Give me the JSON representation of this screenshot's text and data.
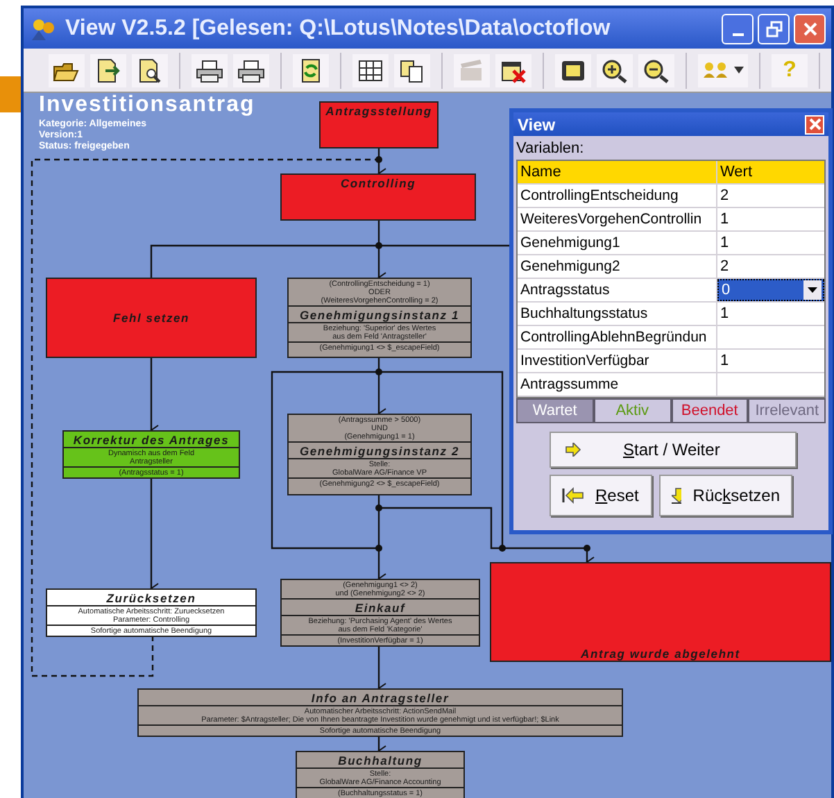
{
  "window": {
    "title": "View  V2.5.2  [Gelesen: Q:\\Lotus\\Notes\\Data\\octoflow"
  },
  "toolbar": {
    "help_glyph": "?"
  },
  "process": {
    "title": "Investitionsantrag",
    "meta": [
      "Kategorie: Allgemeines",
      "Version:1",
      "Status: freigegeben"
    ]
  },
  "nodes": [
    {
      "color": "#ec1c24",
      "sections": [
        {
          "kind": "title",
          "lines": [
            "Antragsstellung"
          ]
        }
      ]
    },
    {
      "color": "#ec1c24",
      "sections": [
        {
          "kind": "title",
          "lines": [
            "Controlling"
          ]
        }
      ]
    },
    {
      "color": "#ec1c24",
      "sections": [
        {
          "kind": "title",
          "lines": [
            "Fehl setzen"
          ]
        }
      ]
    },
    {
      "color": "#a59c98",
      "sections": [
        {
          "kind": "condition",
          "lines": [
            "(ControllingEntscheidung = 1)",
            "ODER",
            "(WeiteresVorgehenControlling = 2)"
          ]
        },
        {
          "kind": "title",
          "lines": [
            "Genehmigungsinstanz 1"
          ]
        },
        {
          "kind": "detail",
          "lines": [
            "Beziehung: 'Superior' des Wertes",
            "aus dem Feld 'Antragsteller'"
          ]
        },
        {
          "kind": "result",
          "lines": [
            "(Genehmigung1 <> $_escapeField)"
          ]
        }
      ]
    },
    {
      "color": "#66c21a",
      "sections": [
        {
          "kind": "title",
          "lines": [
            "Korrektur des Antrages"
          ]
        },
        {
          "kind": "detail",
          "lines": [
            "Dynamisch aus dem Feld",
            "Antragsteller"
          ]
        },
        {
          "kind": "result",
          "lines": [
            "(Antragsstatus = 1)"
          ]
        }
      ]
    },
    {
      "color": "#a59c98",
      "sections": [
        {
          "kind": "condition",
          "lines": [
            "(Antragssumme > 5000)",
            "UND",
            "(Genehmigung1 = 1)"
          ]
        },
        {
          "kind": "title",
          "lines": [
            "Genehmigungsinstanz 2"
          ]
        },
        {
          "kind": "detail",
          "lines": [
            "Stelle:",
            "GlobalWare AG/Finance VP"
          ]
        },
        {
          "kind": "result",
          "lines": [
            "(Genehmigung2 <> $_escapeField)"
          ]
        }
      ]
    },
    {
      "color": "#ffffff",
      "sections": [
        {
          "kind": "title",
          "lines": [
            "Zurücksetzen"
          ]
        },
        {
          "kind": "detail",
          "lines": [
            "Automatische Arbeitsschritt: Zuruecksetzen",
            "Parameter: Controlling"
          ]
        },
        {
          "kind": "result",
          "lines": [
            "Sofortige automatische Beendigung"
          ]
        }
      ]
    },
    {
      "color": "#a59c98",
      "sections": [
        {
          "kind": "condition",
          "lines": [
            "(Genehmigung1 <> 2)",
            "und (Genehmigung2 <> 2)"
          ]
        },
        {
          "kind": "title",
          "lines": [
            "Einkauf"
          ]
        },
        {
          "kind": "detail",
          "lines": [
            "Beziehung: 'Purchasing Agent' des Wertes",
            "aus dem Feld 'Kategorie'"
          ]
        },
        {
          "kind": "result",
          "lines": [
            "(InvestitionVerfügbar = 1)"
          ]
        }
      ]
    },
    {
      "color": "#ec1c24",
      "sections": [
        {
          "kind": "title",
          "lines": [
            "Antrag wurde abgelehnt"
          ]
        }
      ]
    },
    {
      "color": "#a59c98",
      "sections": [
        {
          "kind": "title",
          "lines": [
            "Info an Antragsteller"
          ]
        },
        {
          "kind": "detail",
          "lines": [
            "Automatischer Arbeitsschritt: ActionSendMail",
            "Parameter: $Antragsteller; Die von Ihnen beantragte Investition wurde genehmigt und ist verfügbar!; $Link"
          ]
        },
        {
          "kind": "result",
          "lines": [
            "Sofortige automatische Beendigung"
          ]
        }
      ]
    },
    {
      "color": "#a59c98",
      "sections": [
        {
          "kind": "title",
          "lines": [
            "Buchhaltung"
          ]
        },
        {
          "kind": "detail",
          "lines": [
            "Stelle:",
            "GlobalWare AG/Finance Accounting"
          ]
        },
        {
          "kind": "result",
          "lines": [
            "(Buchhaltungsstatus = 1)"
          ]
        }
      ]
    }
  ],
  "dialog": {
    "title": "View",
    "section_label": "Variablen:",
    "columns": [
      "Name",
      "Wert"
    ],
    "rows": [
      {
        "name": "ControllingEntscheidung",
        "value": "2",
        "kind": "text",
        "selected": false
      },
      {
        "name": "WeiteresVorgehenControllin",
        "value": "1",
        "kind": "text",
        "selected": false
      },
      {
        "name": "Genehmigung1",
        "value": "1",
        "kind": "text",
        "selected": false
      },
      {
        "name": "Genehmigung2",
        "value": "2",
        "kind": "text",
        "selected": false
      },
      {
        "name": "Antragsstatus",
        "value": "0",
        "kind": "dropdown",
        "selected": true
      },
      {
        "name": "Buchhaltungsstatus",
        "value": "1",
        "kind": "text",
        "selected": false
      },
      {
        "name": "ControllingAblehnBegründun",
        "kind": "text",
        "selected": false
      },
      {
        "name": "InvestitionVerfügbar",
        "value": "1",
        "kind": "text",
        "selected": false
      },
      {
        "name": "Antragssumme",
        "kind": "text",
        "selected": false
      }
    ],
    "legend": [
      "Wartet",
      "Aktiv",
      "Beendet",
      "Irrelevant"
    ],
    "buttons": [
      {
        "kind": "start",
        "key": "S",
        "rest": "tart / Weiter"
      },
      {
        "kind": "reset",
        "key": "R",
        "rest": "eset"
      },
      {
        "kind": "back",
        "pre": "Rüc",
        "key": "k",
        "rest": "setzen"
      }
    ]
  }
}
